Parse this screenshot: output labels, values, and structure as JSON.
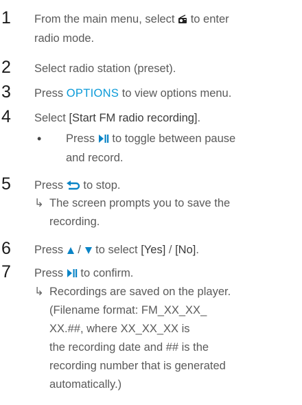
{
  "steps": [
    {
      "number": "1",
      "line1_pre": "From the main menu, select",
      "line1_post": "to enter",
      "line2": "radio mode."
    },
    {
      "number": "2",
      "line1": "Select radio station (preset)."
    },
    {
      "number": "3",
      "line1_pre": "Press",
      "line1_key": "OPTIONS",
      "line1_post": "to view options menu."
    },
    {
      "number": "4",
      "line1_pre": "Select",
      "line1_key": "[Start FM radio recording]",
      "line1_post": ".",
      "bullet_pre": "Press",
      "bullet_post": "to toggle between pause",
      "bullet_line2": "and record."
    },
    {
      "number": "5",
      "line1_pre": "Press",
      "line1_post": "to stop.",
      "result_line1": "The screen prompts you to save the",
      "result_line2": "recording."
    },
    {
      "number": "6",
      "line1_pre": "Press",
      "slash": "/",
      "line1_mid": "to select",
      "opt_yes": "[Yes]",
      "opt_sep": "/",
      "opt_no": "[No]",
      "line1_end": "."
    },
    {
      "number": "7",
      "line1_pre": "Press",
      "line1_post": "to confirm.",
      "result_lines": [
        "Recordings are saved on the player.",
        "(Filename format: FM_XX_XX_",
        "XX.##, where XX_XX_XX is",
        "the recording date and ## is the",
        "recording number that is generated",
        "automatically.)"
      ]
    }
  ],
  "icons": {
    "radio": "radio-icon",
    "play_pause": "play-pause-icon",
    "back": "back-icon",
    "up": "up-triangle-icon",
    "down": "down-triangle-icon",
    "result": "result-arrow-icon"
  },
  "colors": {
    "accent": "#0a84c6",
    "text": "#5a5a5a",
    "number": "#1a1a1a"
  }
}
